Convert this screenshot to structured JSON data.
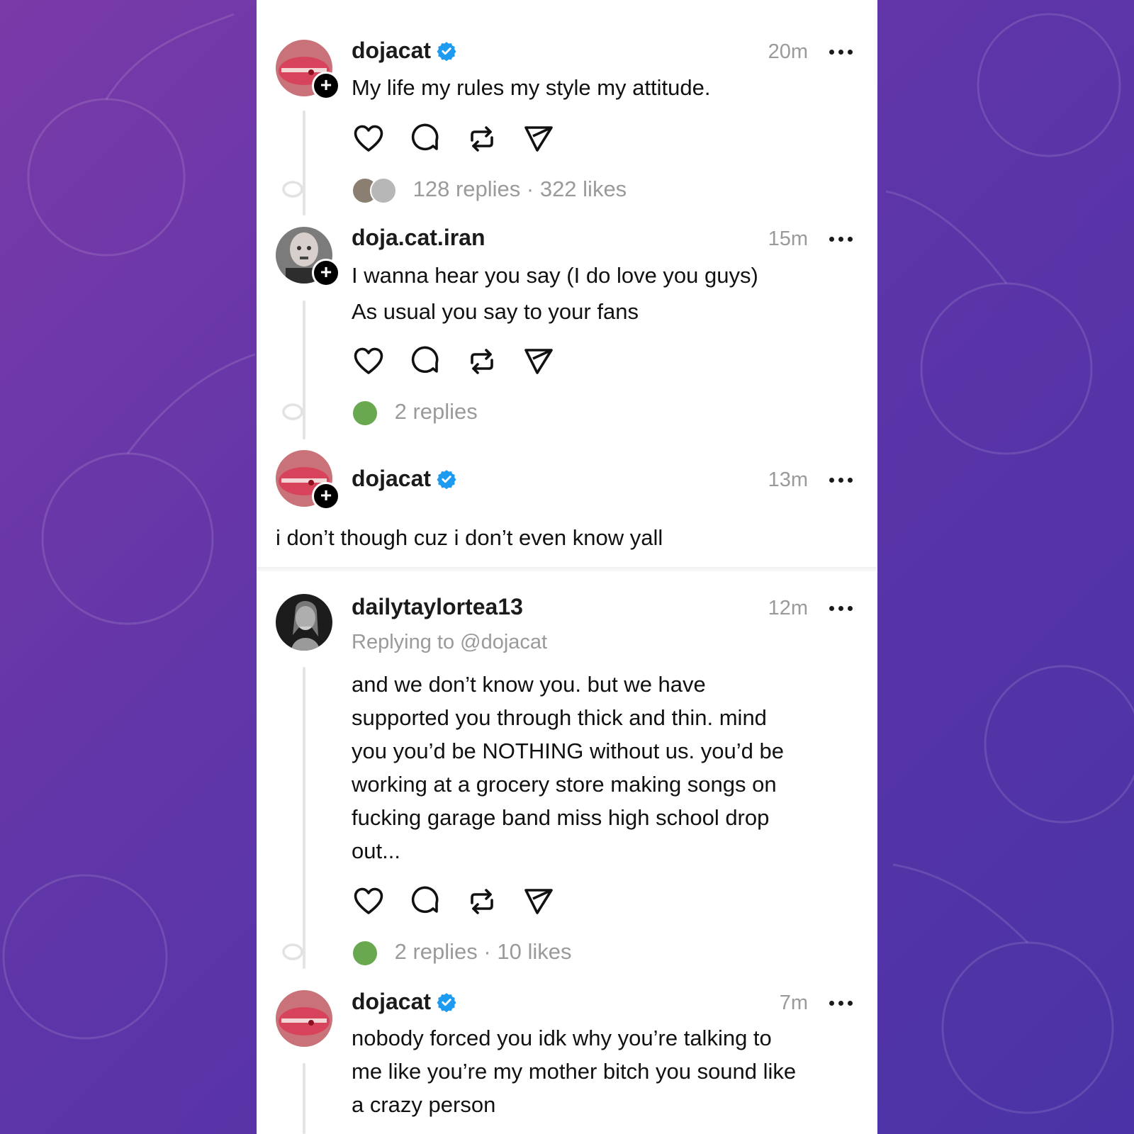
{
  "colors": {
    "background_start": "#7a3aa8",
    "background_end": "#4a33a6",
    "verified_blue": "#1d9bf0",
    "meta_gray": "#9a9a9a"
  },
  "posts": [
    {
      "username": "dojacat",
      "verified": true,
      "time": "20m",
      "lines": [
        "My life my rules my style my attitude."
      ],
      "stats": "128 replies · 322 likes",
      "avatar": "lips-avatar",
      "follow_badge": true
    },
    {
      "username": "doja.cat.iran",
      "verified": false,
      "time": "15m",
      "lines": [
        "I wanna hear you say (I do love you guys)",
        "As usual you say to your fans"
      ],
      "stats": "2 replies",
      "avatar": "portrait-avatar",
      "follow_badge": true
    },
    {
      "username": "dojacat",
      "verified": true,
      "time": "13m",
      "lines": [
        "i don’t though cuz i don’t even know yall"
      ],
      "avatar": "lips-avatar",
      "follow_badge": true
    },
    {
      "username": "dailytaylortea13",
      "verified": false,
      "time": "12m",
      "replying_to": "Replying to @dojacat",
      "lines": [
        "and we don’t know you. but we have",
        "supported you through thick and thin. mind",
        "you you’d be NOTHING without us. you’d be",
        "working at a grocery store making songs on",
        "fucking garage band miss high school drop",
        "out..."
      ],
      "stats": "2 replies · 10 likes",
      "avatar": "singer-avatar",
      "follow_badge": false
    },
    {
      "username": "dojacat",
      "verified": true,
      "time": "7m",
      "lines": [
        "nobody forced you idk why you’re talking to",
        "me like you’re my mother bitch you sound like",
        "a crazy person"
      ],
      "avatar": "lips-avatar",
      "follow_badge": false
    }
  ],
  "icons": {
    "like": "heart-icon",
    "comment": "comment-icon",
    "repost": "repost-icon",
    "share": "send-icon",
    "more": "more-icon",
    "verified": "verified-badge-icon",
    "follow": "plus-icon"
  }
}
